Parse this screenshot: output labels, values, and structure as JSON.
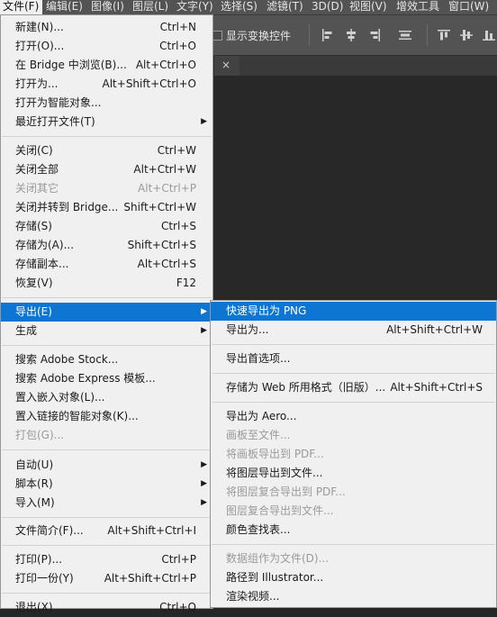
{
  "menubar": {
    "items": [
      {
        "label": "文件(F)"
      },
      {
        "label": "编辑(E)"
      },
      {
        "label": "图像(I)"
      },
      {
        "label": "图层(L)"
      },
      {
        "label": "文字(Y)"
      },
      {
        "label": "选择(S)"
      },
      {
        "label": "滤镜(T)"
      },
      {
        "label": "3D(D)"
      },
      {
        "label": "视图(V)"
      },
      {
        "label": "增效工具"
      },
      {
        "label": "窗口(W)"
      }
    ]
  },
  "options": {
    "show_transform_label": "显示变换控件"
  },
  "document": {
    "close_glyph": "×"
  },
  "file_menu": {
    "items": [
      {
        "label": "新建(N)...",
        "shortcut": "Ctrl+N"
      },
      {
        "label": "打开(O)...",
        "shortcut": "Ctrl+O"
      },
      {
        "label": "在 Bridge 中浏览(B)...",
        "shortcut": "Alt+Ctrl+O"
      },
      {
        "label": "打开为...",
        "shortcut": "Alt+Shift+Ctrl+O"
      },
      {
        "label": "打开为智能对象...",
        "shortcut": ""
      },
      {
        "label": "最近打开文件(T)",
        "shortcut": ""
      },
      {
        "label": "关闭(C)",
        "shortcut": "Ctrl+W"
      },
      {
        "label": "关闭全部",
        "shortcut": "Alt+Ctrl+W"
      },
      {
        "label": "关闭其它",
        "shortcut": "Alt+Ctrl+P"
      },
      {
        "label": "关闭并转到 Bridge...",
        "shortcut": "Shift+Ctrl+W"
      },
      {
        "label": "存储(S)",
        "shortcut": "Ctrl+S"
      },
      {
        "label": "存储为(A)...",
        "shortcut": "Shift+Ctrl+S"
      },
      {
        "label": "存储副本...",
        "shortcut": "Alt+Ctrl+S"
      },
      {
        "label": "恢复(V)",
        "shortcut": "F12"
      },
      {
        "label": "导出(E)",
        "shortcut": ""
      },
      {
        "label": "生成",
        "shortcut": ""
      },
      {
        "label": "搜索 Adobe Stock...",
        "shortcut": ""
      },
      {
        "label": "搜索 Adobe Express 模板...",
        "shortcut": ""
      },
      {
        "label": "置入嵌入对象(L)...",
        "shortcut": ""
      },
      {
        "label": "置入链接的智能对象(K)...",
        "shortcut": ""
      },
      {
        "label": "打包(G)...",
        "shortcut": ""
      },
      {
        "label": "自动(U)",
        "shortcut": ""
      },
      {
        "label": "脚本(R)",
        "shortcut": ""
      },
      {
        "label": "导入(M)",
        "shortcut": ""
      },
      {
        "label": "文件简介(F)...",
        "shortcut": "Alt+Shift+Ctrl+I"
      },
      {
        "label": "打印(P)...",
        "shortcut": "Ctrl+P"
      },
      {
        "label": "打印一份(Y)",
        "shortcut": "Alt+Shift+Ctrl+P"
      },
      {
        "label": "退出(X)",
        "shortcut": "Ctrl+Q"
      }
    ]
  },
  "export_menu": {
    "items": [
      {
        "label": "快速导出为 PNG",
        "shortcut": ""
      },
      {
        "label": "导出为...",
        "shortcut": "Alt+Shift+Ctrl+W"
      },
      {
        "label": "导出首选项...",
        "shortcut": ""
      },
      {
        "label": "存储为 Web 所用格式（旧版）...",
        "shortcut": "Alt+Shift+Ctrl+S"
      },
      {
        "label": "导出为 Aero...",
        "shortcut": ""
      },
      {
        "label": "画板至文件...",
        "shortcut": ""
      },
      {
        "label": "将画板导出到 PDF...",
        "shortcut": ""
      },
      {
        "label": "将图层导出到文件...",
        "shortcut": ""
      },
      {
        "label": "将图层复合导出到 PDF...",
        "shortcut": ""
      },
      {
        "label": "图层复合导出到文件...",
        "shortcut": ""
      },
      {
        "label": "颜色查找表...",
        "shortcut": ""
      },
      {
        "label": "数据组作为文件(D)...",
        "shortcut": ""
      },
      {
        "label": "路径到 Illustrator...",
        "shortcut": ""
      },
      {
        "label": "渲染视频...",
        "shortcut": ""
      }
    ]
  },
  "colors": {
    "highlight": "#0c76d2",
    "menu_bg": "#f0f0f0",
    "chrome": "#535353"
  }
}
